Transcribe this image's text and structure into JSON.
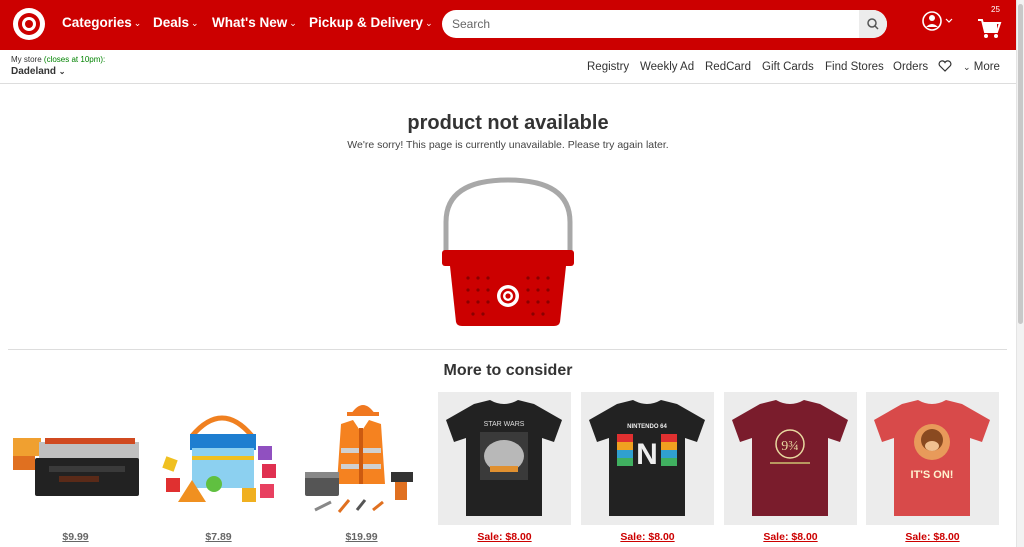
{
  "header": {
    "nav": [
      {
        "label": "Categories"
      },
      {
        "label": "Deals"
      },
      {
        "label": "What's New"
      },
      {
        "label": "Pickup & Delivery"
      }
    ],
    "search_placeholder": "Search",
    "cart_count": "25",
    "brand_color": "#cc0000"
  },
  "store": {
    "label_prefix": "My store",
    "hours": "(closes at 10pm):",
    "name": "Dadeland"
  },
  "utility_links": [
    "Registry",
    "Weekly Ad",
    "RedCard",
    "Gift Cards",
    "Find Stores",
    "Orders"
  ],
  "more_label": "More",
  "main": {
    "title": "product not available",
    "subtitle": "We're sorry! This page is currently unavailable. Please try again later."
  },
  "recommendations": {
    "title": "More to consider",
    "products": [
      {
        "icon": "toolbox-toy",
        "price": "$9.99",
        "sale": false
      },
      {
        "icon": "shape-sorter-toy",
        "price": "$7.89",
        "sale": false
      },
      {
        "icon": "construction-costume",
        "price": "$19.99",
        "sale": false
      },
      {
        "icon": "star-wars-tshirt",
        "thumb_text": "STAR WARS",
        "price": "Sale: $8.00",
        "sale": true
      },
      {
        "icon": "nintendo-tshirt",
        "thumb_text": "NINTENDO 64",
        "price": "Sale: $8.00",
        "sale": true
      },
      {
        "icon": "harry-potter-tshirt",
        "thumb_text": "9¾",
        "price": "Sale: $8.00",
        "sale": true
      },
      {
        "icon": "donkey-kong-tshirt",
        "thumb_text": "IT'S ON!",
        "price": "Sale: $8.00",
        "sale": true
      }
    ]
  }
}
